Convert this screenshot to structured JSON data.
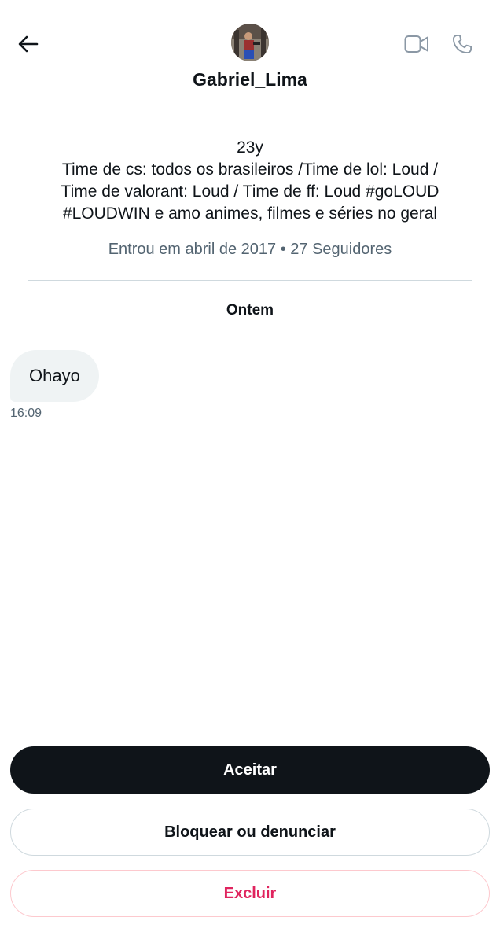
{
  "header": {
    "back_icon": "arrow-left-icon",
    "video_icon": "video-camera-icon",
    "call_icon": "phone-icon",
    "username": "Gabriel_Lima"
  },
  "profile": {
    "bio_lines": [
      "23y",
      "Time de cs: todos os brasileiros /Time de lol: Loud /",
      "Time de valorant: Loud / Time de ff: Loud #goLOUD",
      "#LOUDWIN e amo animes, filmes e séries no geral"
    ],
    "meta": "Entrou em abril de 2017 • 27 Seguidores"
  },
  "conversation": {
    "date_label": "Ontem",
    "messages": [
      {
        "text": "Ohayo",
        "time": "16:09"
      }
    ]
  },
  "actions": {
    "accept_label": "Aceitar",
    "block_label": "Bloquear ou denunciar",
    "delete_label": "Excluir"
  },
  "colors": {
    "primary_text": "#0f1419",
    "secondary_text": "#536471",
    "accept_bg": "#0f1419",
    "danger": "#e0245e",
    "bubble_bg": "#eff3f4",
    "border": "#cfd9de"
  }
}
